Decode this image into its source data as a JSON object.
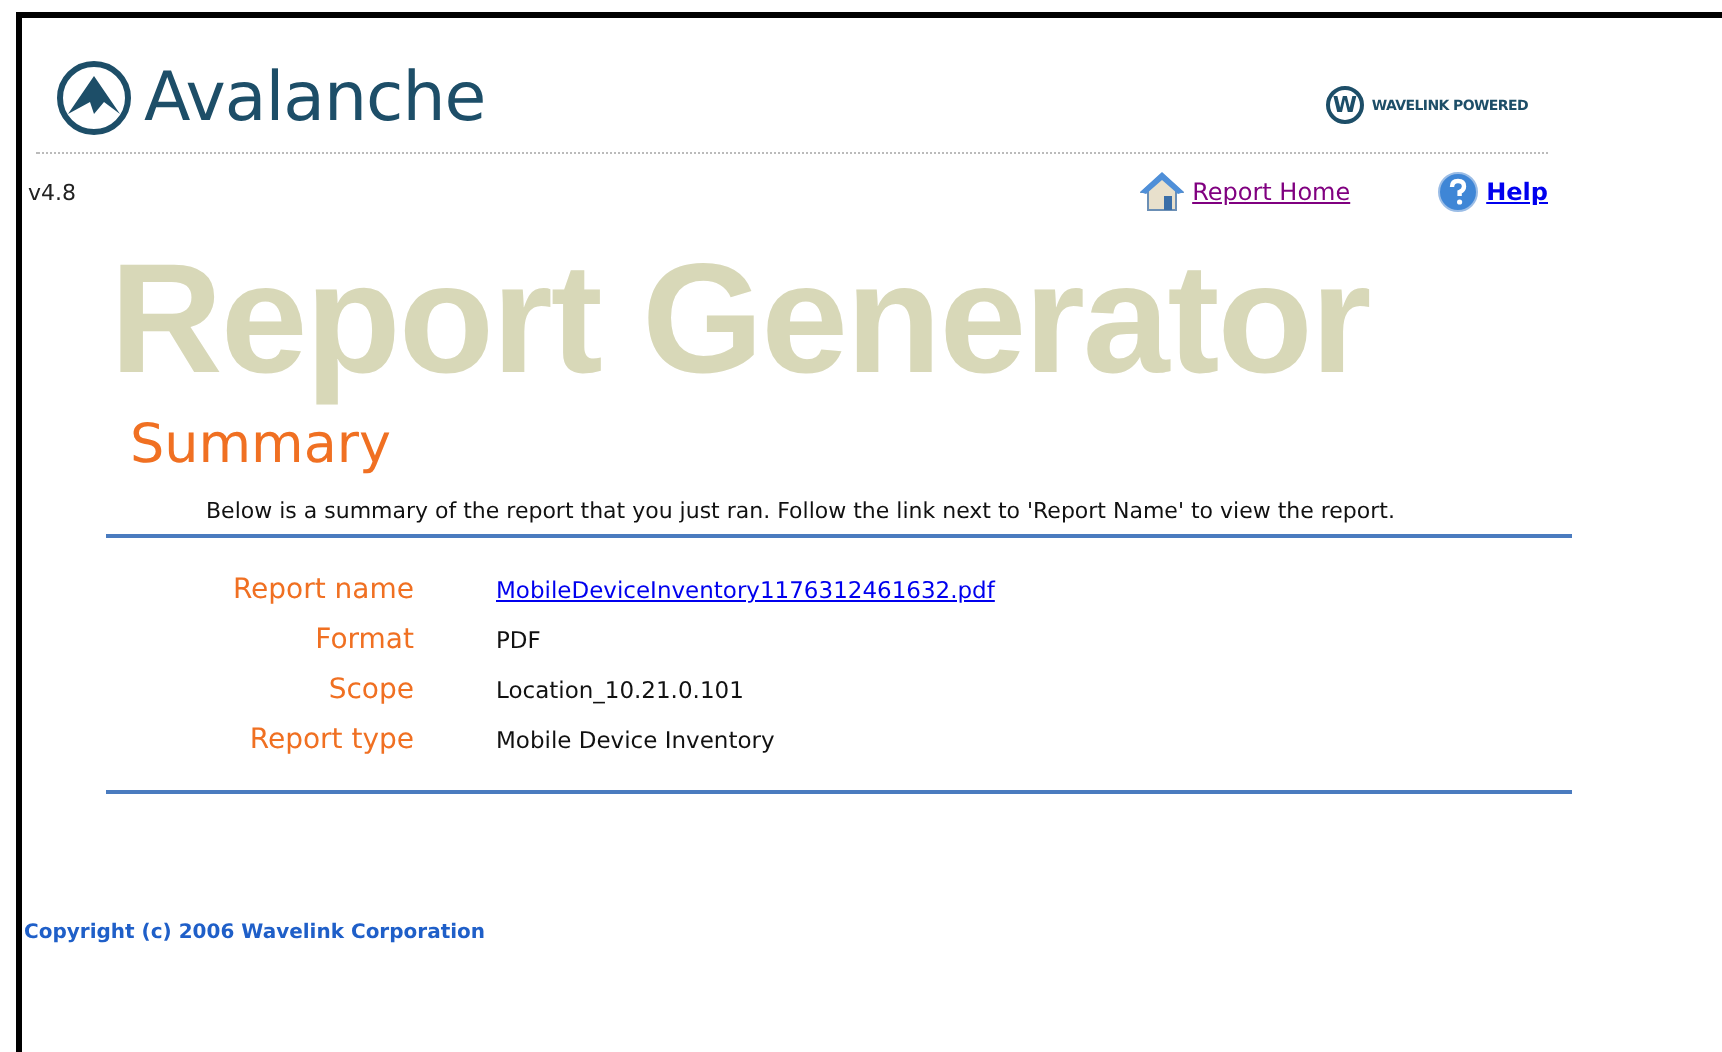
{
  "header": {
    "logo_text": "Avalanche",
    "partner_mark": "W",
    "partner_text": "WAVELINK POWERED"
  },
  "version": "v4.8",
  "nav_links": [
    {
      "kind": "home",
      "label": "Report Home",
      "visited": true
    },
    {
      "kind": "help",
      "label": "Help",
      "visited": false
    }
  ],
  "watermark": "Report Generator",
  "title": "Summary",
  "intro": "Below is a summary of the report that you just ran. Follow the link next to 'Report Name' to view the report.",
  "details": [
    {
      "label": "Report name",
      "value": "MobileDeviceInventory1176312461632.pdf",
      "kind": "link"
    },
    {
      "label": "Format",
      "value": "PDF",
      "kind": "text"
    },
    {
      "label": "Scope",
      "value": "Location_10.21.0.101",
      "kind": "text"
    },
    {
      "label": "Report type",
      "value": "Mobile Device Inventory",
      "kind": "text"
    }
  ],
  "footer": "Copyright (c) 2006 Wavelink Corporation"
}
